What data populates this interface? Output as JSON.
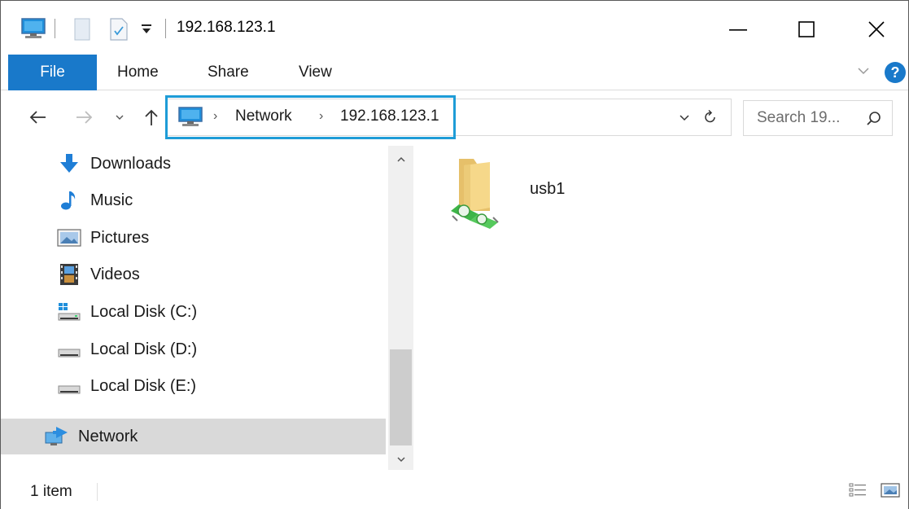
{
  "window": {
    "title": "192.168.123.1",
    "minimize_glyph": "—",
    "maximize_glyph": "☐",
    "close_glyph": "✕"
  },
  "ribbon": {
    "tabs": [
      {
        "label": "File",
        "active": true
      },
      {
        "label": "Home"
      },
      {
        "label": "Share"
      },
      {
        "label": "View"
      }
    ],
    "help_glyph": "?"
  },
  "address": {
    "breadcrumbs": [
      "Network",
      "192.168.123.1"
    ],
    "search_placeholder": "Search 19...",
    "highlight_color": "#1e9cd7"
  },
  "nav_pane": {
    "items": [
      {
        "label": "Downloads",
        "icon": "downloads-icon"
      },
      {
        "label": "Music",
        "icon": "music-icon"
      },
      {
        "label": "Pictures",
        "icon": "pictures-icon"
      },
      {
        "label": "Videos",
        "icon": "videos-icon"
      },
      {
        "label": "Local Disk (C:)",
        "icon": "system-drive-icon"
      },
      {
        "label": "Local Disk (D:)",
        "icon": "drive-icon"
      },
      {
        "label": "Local Disk (E:)",
        "icon": "drive-icon"
      },
      {
        "label": "Network",
        "icon": "network-icon",
        "selected": true
      }
    ]
  },
  "content": {
    "items": [
      {
        "name": "usb1",
        "icon": "shared-folder-icon"
      }
    ]
  },
  "status": {
    "item_count": "1 item"
  },
  "colors": {
    "accent": "#1979ca",
    "selection": "#d9d9d9"
  }
}
